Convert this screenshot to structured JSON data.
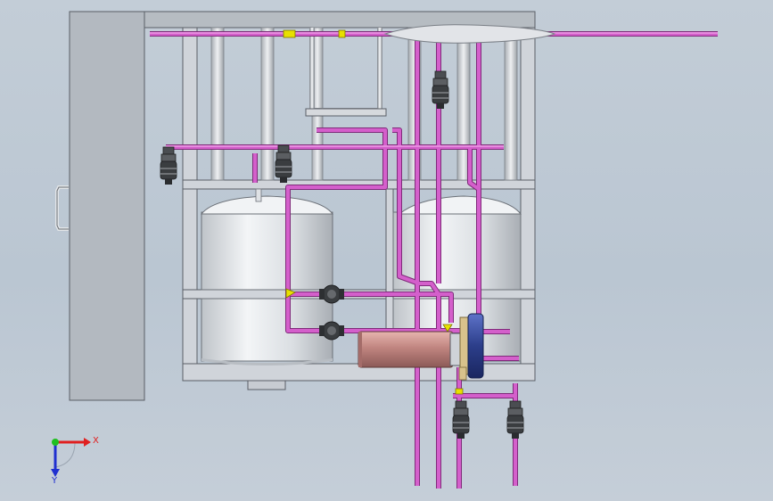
{
  "viewport": {
    "triad": {
      "x_label": "X",
      "y_label": "Y"
    }
  },
  "colors": {
    "background": "#bec9d4",
    "pipe": "#cc55c4",
    "pipe_edge": "#8a2c84",
    "frame": "#d0d4da",
    "frame_edge": "#5a5e66",
    "tank": "#e4e7ea",
    "panel": "#b6bcc2",
    "valve": "#3a3d40",
    "flange": "#e8e000",
    "heat_exchanger": "#c98a86",
    "motor_blue": "#2c3e8a",
    "motor_tan": "#d8c28c",
    "axis_x": "#e02020",
    "axis_y": "#20c020",
    "axis_z": "#2030d0"
  }
}
